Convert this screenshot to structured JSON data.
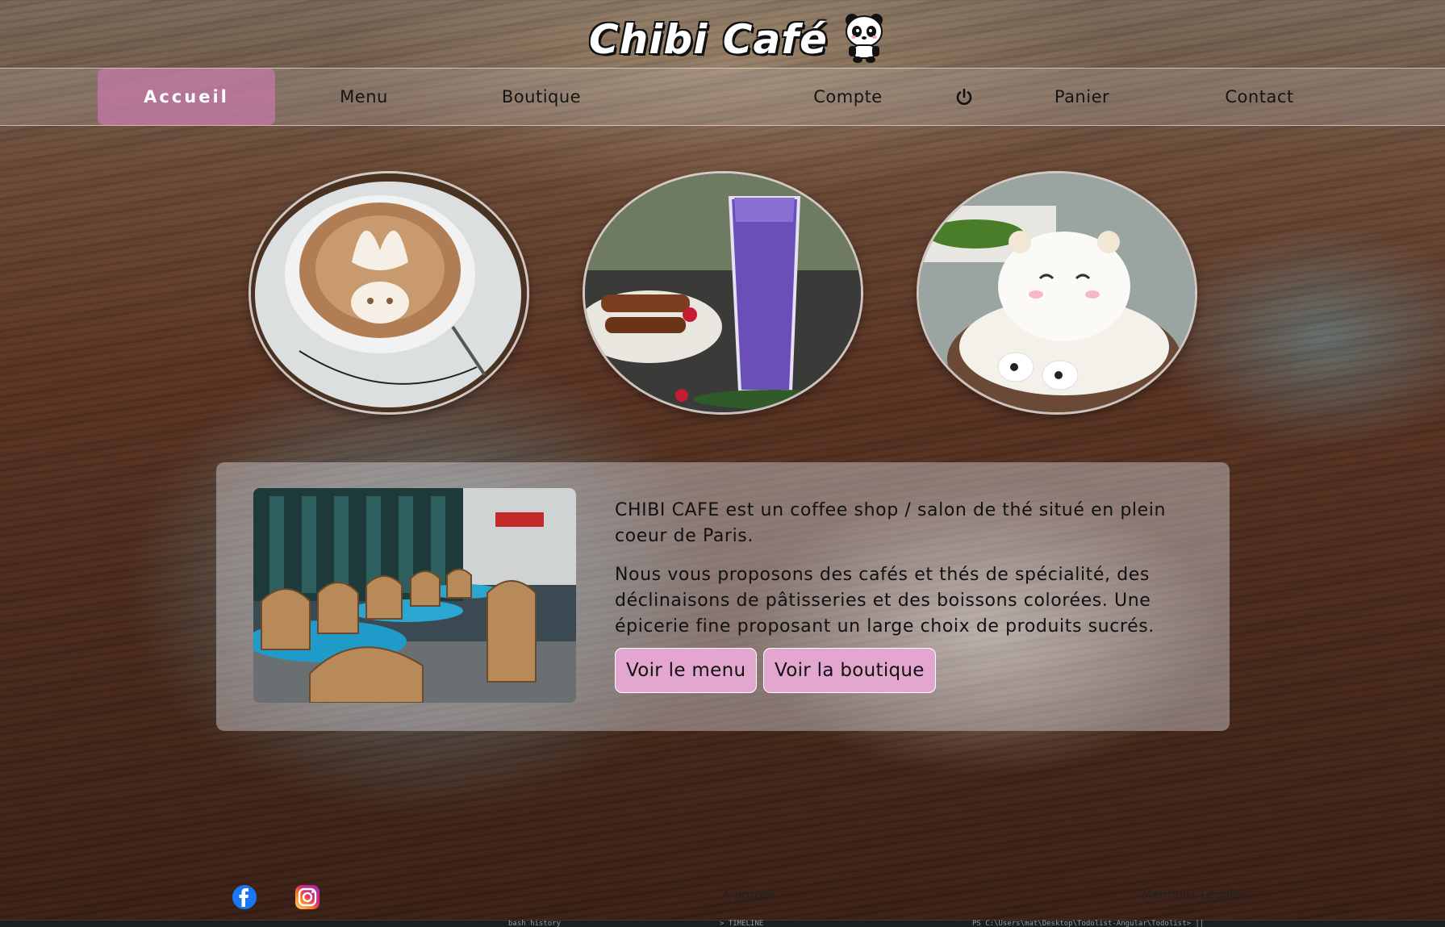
{
  "brand": {
    "title": "Chibi Café",
    "mascot_icon": "panda-mascot-icon"
  },
  "nav": {
    "items": [
      {
        "label": "Accueil",
        "active": true
      },
      {
        "label": "Menu"
      },
      {
        "label": "Boutique"
      },
      {
        "label": "Compte"
      },
      {
        "label": "",
        "icon": "power-icon"
      },
      {
        "label": "Panier"
      },
      {
        "label": "Contact"
      }
    ]
  },
  "gallery": [
    {
      "icon": "latte-art-bunny-image"
    },
    {
      "icon": "purple-smoothie-image"
    },
    {
      "icon": "bear-latte-art-image"
    }
  ],
  "intro": {
    "paragraph_1": "CHIBI CAFE est un coffee shop / salon de thé situé en plein coeur de Paris.",
    "paragraph_2": "Nous vous proposons des cafés et thés de spécialité, des déclinaisons de pâtisseries et des boissons colorées. Une épicerie fine proposant un large choix de produits sucrés.",
    "menu_button": "Voir le menu",
    "shop_button": "Voir la boutique",
    "photo_icon": "parisian-terrace-image"
  },
  "footer": {
    "facebook_icon": "facebook-icon",
    "instagram_icon": "instagram-icon",
    "about": "A propos",
    "legal": "Mentions Légales"
  },
  "taskbar": {
    "items": [
      "bash history",
      "> TIMELINE",
      "PS C:\\Users\\mat\\Desktop\\Todolist-Angular\\Todolist> ||"
    ]
  },
  "colors": {
    "accent_pink": "#e3a7cf",
    "active_nav": "#c878aa",
    "panel": "rgba(225,225,230,0.42)"
  }
}
